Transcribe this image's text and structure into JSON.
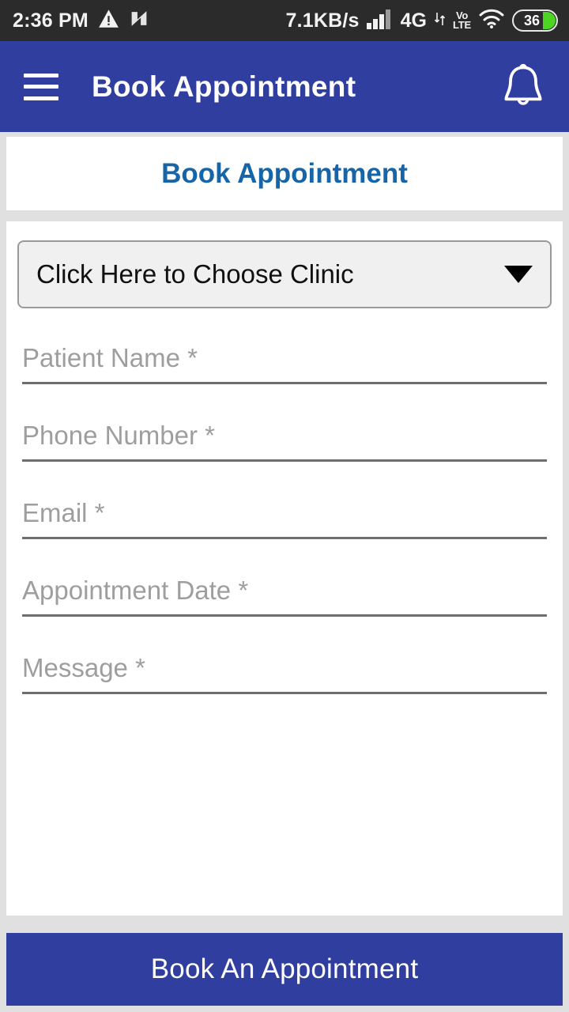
{
  "status_bar": {
    "time": "2:36 PM",
    "warning_icon": "warning-triangle-icon",
    "nova_icon": "nova-n-icon",
    "network_speed": "7.1KB/s",
    "signal_icon": "signal-bars-icon",
    "network_type": "4G",
    "data_arrows_icon": "data-transfer-icon",
    "volte_line1": "Vo",
    "volte_line2": "LTE",
    "wifi_icon": "wifi-icon",
    "battery_level": "36"
  },
  "app_bar": {
    "menu_icon": "hamburger-menu-icon",
    "title": "Book Appointment",
    "notification_icon": "bell-icon",
    "background_color": "#303f9f"
  },
  "header_card": {
    "title": "Book Appointment",
    "title_color": "#1565a8"
  },
  "form": {
    "clinic_select": {
      "value": "Click Here to Choose Clinic",
      "caret_icon": "chevron-down-icon"
    },
    "fields": [
      {
        "name": "patient-name",
        "placeholder": "Patient Name *"
      },
      {
        "name": "phone-number",
        "placeholder": "Phone Number *"
      },
      {
        "name": "email",
        "placeholder": "Email *"
      },
      {
        "name": "appointment-date",
        "placeholder": "Appointment Date *"
      },
      {
        "name": "message",
        "placeholder": "Message *"
      }
    ]
  },
  "submit": {
    "label": "Book An Appointment",
    "background_color": "#303f9f"
  }
}
